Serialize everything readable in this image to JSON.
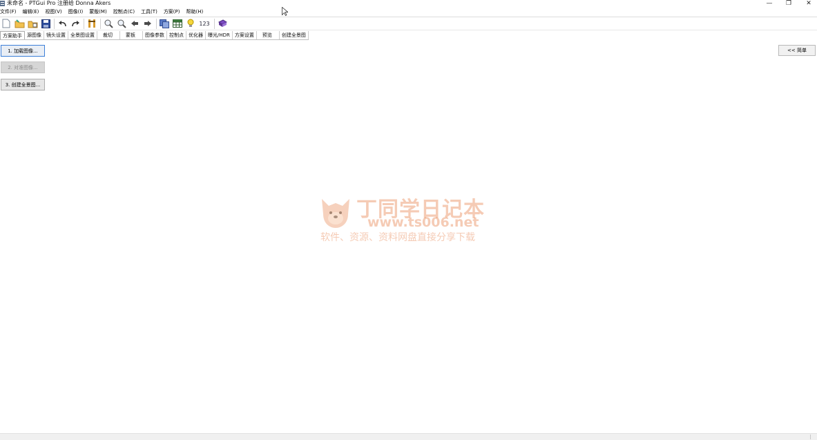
{
  "window": {
    "title": "未命名 - PTGui Pro 注册给 Donna Akers",
    "minimize_glyph": "—",
    "restore_glyph": "❐",
    "close_glyph": "✕"
  },
  "menubar": {
    "items": [
      {
        "label": "文件(F)"
      },
      {
        "label": "编辑(E)"
      },
      {
        "label": "视图(V)"
      },
      {
        "label": "图像(I)"
      },
      {
        "label": "蒙版(M)"
      },
      {
        "label": "控制点(C)"
      },
      {
        "label": "工具(T)"
      },
      {
        "label": "方案(P)"
      },
      {
        "label": "帮助(H)"
      }
    ]
  },
  "toolbar": {
    "numbers_label": "123"
  },
  "tabs": [
    {
      "label": "方案助手"
    },
    {
      "label": "源图像"
    },
    {
      "label": "镜头设置"
    },
    {
      "label": "全景图设置"
    },
    {
      "label": "裁切"
    },
    {
      "label": "蒙板"
    },
    {
      "label": "图像参数"
    },
    {
      "label": "控制点"
    },
    {
      "label": "优化器"
    },
    {
      "label": "曝光/HDR"
    },
    {
      "label": "方案设置"
    },
    {
      "label": "预览"
    },
    {
      "label": "创建全景图"
    }
  ],
  "assistant": {
    "load_images": "1. 加载图像...",
    "align_images": "2. 对准图像...",
    "create_panorama": "3. 创建全景图..."
  },
  "menu_toggle": "<< 简单",
  "watermark": {
    "title": "丁同学日记本",
    "url": "www.ts006.net",
    "subtitle": "软件、资源、资料网盘直接分享下载"
  },
  "colors": {
    "focus_border": "#3b7ed8",
    "watermark": "#e88c5a"
  }
}
